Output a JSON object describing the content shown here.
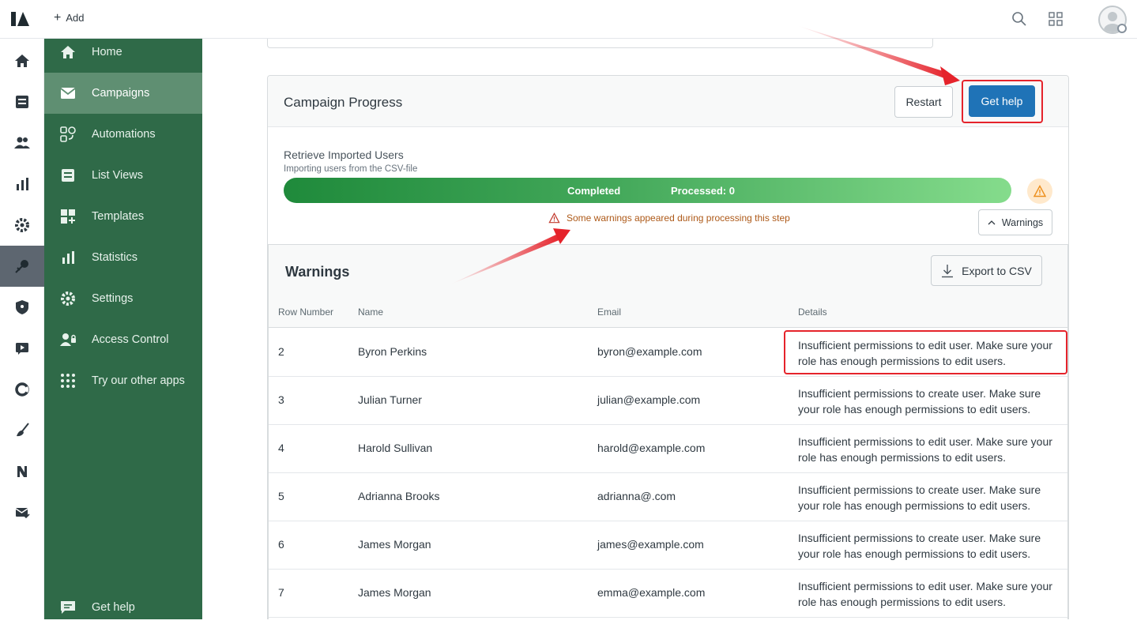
{
  "topbar": {
    "add_label": "Add",
    "icons": [
      "search-icon",
      "apps-grid-icon",
      "user-avatar-icon"
    ]
  },
  "rail": {
    "icons": [
      "home-icon",
      "inbox-icon",
      "users-icon",
      "chart-icon",
      "gear-icon",
      "integration-icon",
      "shield-icon",
      "video-icon",
      "pie-icon",
      "broom-icon",
      "n-logo-icon",
      "mail-check-icon"
    ],
    "active_index": 5
  },
  "sidenav": {
    "items": [
      {
        "label": "Home",
        "icon": "home-icon"
      },
      {
        "label": "Campaigns",
        "icon": "mail-icon"
      },
      {
        "label": "Automations",
        "icon": "automation-icon"
      },
      {
        "label": "List Views",
        "icon": "list-icon"
      },
      {
        "label": "Templates",
        "icon": "templates-icon"
      },
      {
        "label": "Statistics",
        "icon": "stats-icon"
      },
      {
        "label": "Settings",
        "icon": "gear-icon"
      },
      {
        "label": "Access Control",
        "icon": "access-icon"
      },
      {
        "label": "Try our other apps",
        "icon": "dots-grid-icon"
      }
    ],
    "active_index": 1,
    "footer_label": "Get help"
  },
  "campaign": {
    "title": "Campaign Progress",
    "restart_label": "Restart",
    "help_label": "Get help",
    "step_title": "Retrieve Imported Users",
    "step_subtitle": "Importing users from the CSV-file",
    "status_label": "Completed",
    "processed_label": "Processed: 0",
    "progress": 1.0,
    "warning_message": "Some warnings appeared during processing this step",
    "warnings_toggle_label": "Warnings"
  },
  "warnings": {
    "title": "Warnings",
    "export_label": "Export to CSV",
    "columns": [
      "Row Number",
      "Name",
      "Email",
      "Details"
    ],
    "rows": [
      {
        "row": "2",
        "name": "Byron Perkins",
        "email": "byron@example.com",
        "details": "Insufficient permissions to edit user. Make sure your role has enough permissions to edit users."
      },
      {
        "row": "3",
        "name": "Julian Turner",
        "email": "julian@example.com",
        "details": "Insufficient permissions to create user. Make sure your role has enough permissions to edit users."
      },
      {
        "row": "4",
        "name": "Harold Sullivan",
        "email": "harold@example.com",
        "details": "Insufficient permissions to edit user. Make sure your role has enough permissions to edit users."
      },
      {
        "row": "5",
        "name": "Adrianna Brooks",
        "email": "adrianna@.com",
        "details": "Insufficient permissions to create user. Make sure your role has enough permissions to edit users."
      },
      {
        "row": "6",
        "name": "James Morgan",
        "email": "james@example.com",
        "details": "Insufficient permissions to create user. Make sure your role has enough permissions to edit users."
      },
      {
        "row": "7",
        "name": "James Morgan",
        "email": "emma@example.com",
        "details": "Insufficient permissions to edit user. Make sure your role has enough permissions to edit users."
      }
    ]
  },
  "colors": {
    "sidenav_bg": "#2f6a48",
    "sidenav_active": "#5f8f72",
    "primary_button": "#1f73b7",
    "warning_text": "#ad5918",
    "annotation_red": "#e5232b"
  }
}
